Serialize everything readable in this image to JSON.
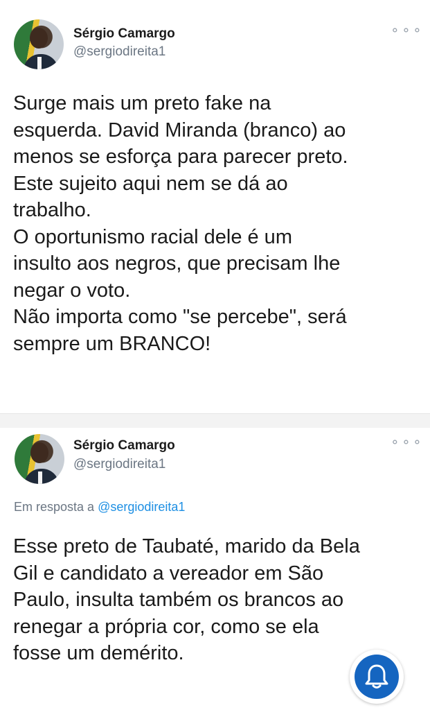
{
  "tweets": [
    {
      "author_name": "Sérgio Camargo",
      "author_handle": "@sergiodireita1",
      "more_icon": "more-dots-icon",
      "text": "Surge mais um preto fake na\nesquerda. David Miranda (branco) ao\nmenos se esforça para parecer preto.\nEste sujeito aqui nem se dá ao\ntrabalho.\nO oportunismo racial dele é um\ninsulto aos negros, que precisam lhe\nnegar o voto.\nNão importa como \"se percebe\", será\nsempre um BRANCO!"
    },
    {
      "author_name": "Sérgio Camargo",
      "author_handle": "@sergiodireita1",
      "more_icon": "more-dots-icon",
      "reply_prefix": "Em resposta a",
      "reply_mention": "@sergiodireita1",
      "text": "Esse preto de Taubaté, marido da Bela\nGil e candidato a vereador em São\nPaulo, insulta também os brancos ao\nrenegar a própria cor, como se ela\nfosse um demérito."
    }
  ],
  "notification_button": {
    "icon": "bell-icon",
    "color": "#1565c0"
  }
}
